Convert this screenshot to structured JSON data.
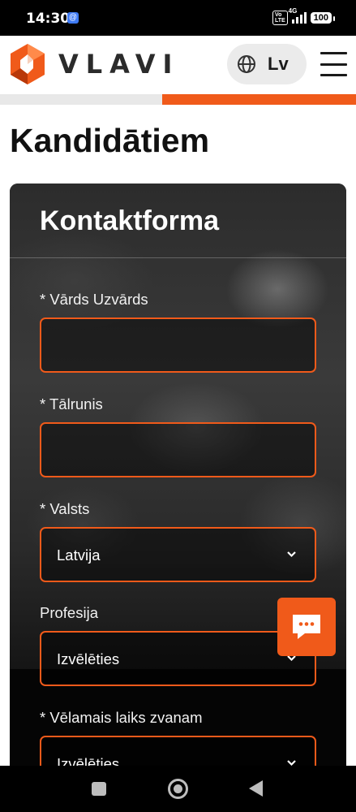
{
  "status_bar": {
    "time": "14:30",
    "volte": "Vo LTE",
    "network": "4G",
    "battery": "100"
  },
  "header": {
    "logo_text": "VLAVI",
    "language": "Lv",
    "brand_color": "#f05a1a"
  },
  "progress": {
    "fraction": 0.545
  },
  "page": {
    "title": "Kandidātiem"
  },
  "form": {
    "title": "Kontaktforma",
    "fields": [
      {
        "label": "* Vārds Uzvārds",
        "value": "",
        "type": "text"
      },
      {
        "label": "* Tālrunis",
        "value": "",
        "type": "tel"
      },
      {
        "label": "* Valsts",
        "value": "Latvija",
        "type": "select"
      },
      {
        "label": "Profesija",
        "value": "Izvēlēties",
        "type": "select"
      },
      {
        "label": "* Vēlamais laiks zvanam",
        "value": "Izvēlēties",
        "type": "select"
      }
    ]
  },
  "icons": {
    "language": "globe-icon",
    "menu": "hamburger-menu-icon",
    "chat": "chat-bubble-icon",
    "select": "chevron-down-icon"
  }
}
